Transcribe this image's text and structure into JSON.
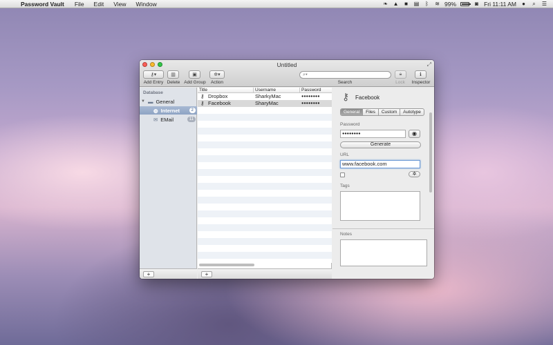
{
  "menubar": {
    "app_name": "Password Vault",
    "menus": [
      "File",
      "Edit",
      "View",
      "Window"
    ],
    "battery": "99%",
    "clock": "Fri 11:11 AM"
  },
  "window": {
    "title": "Untitled",
    "toolbar": {
      "add_entry": "Add Entry",
      "delete": "Delete",
      "add_group": "Add Group",
      "action": "Action",
      "search": "Search",
      "lock": "Lock",
      "inspector": "Inspector"
    }
  },
  "sidebar": {
    "header": "Database",
    "group": "General",
    "items": [
      {
        "label": "Internet",
        "count": "2"
      },
      {
        "label": "EMail",
        "count": "11"
      }
    ],
    "add_label": "+"
  },
  "list": {
    "columns": [
      "Title",
      "Username",
      "Password"
    ],
    "rows": [
      {
        "title": "Dropbox",
        "username": "SharkyMac",
        "password": "●●●●●●●●"
      },
      {
        "title": "Facebook",
        "username": "SharyMac",
        "password": "●●●●●●●●"
      }
    ],
    "add_label": "+"
  },
  "inspector": {
    "title": "Facebook",
    "tabs": [
      "General",
      "Files",
      "Custom",
      "Autotype"
    ],
    "password_label": "Password",
    "password_value": "●●●●●●●●",
    "generate_label": "Generate",
    "url_label": "URL",
    "url_value": "www.facebook.com",
    "tags_label": "Tags",
    "notes_label": "Notes"
  }
}
